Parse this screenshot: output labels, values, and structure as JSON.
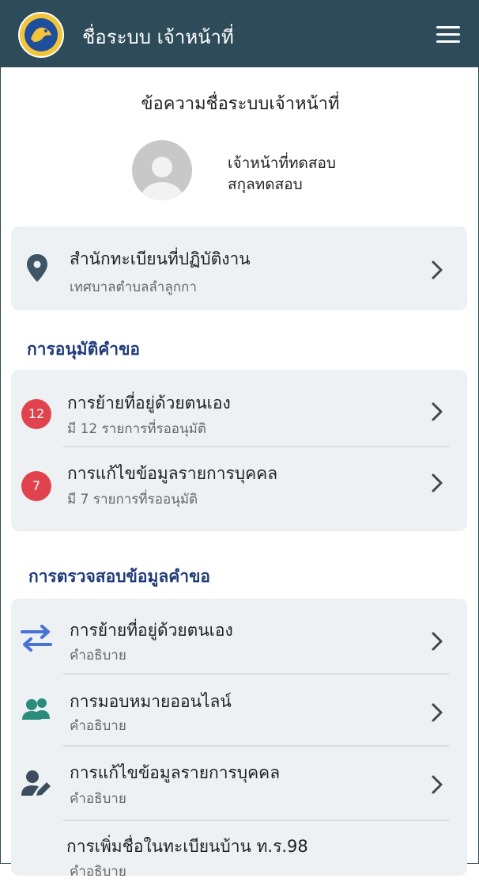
{
  "header": {
    "title": "ชื่อระบบ เจ้าหน้าที่",
    "logo_icon": "department-seal-logo",
    "menu_icon": "hamburger-menu-icon"
  },
  "greeting": "ข้อความชื่อระบบเจ้าหน้าที่",
  "user": {
    "name": "เจ้าหน้าที่ทดสอบ",
    "surname": "สกุลทดสอบ"
  },
  "office": {
    "title": "สำนักทะเบียนที่ปฏิบัติงาน",
    "value": "เทศบาลตำบลลำลูกกา"
  },
  "approval": {
    "section_title": "การอนุมัติคำขอ",
    "items": [
      {
        "badge": "12",
        "title": "การย้ายที่อยู่ด้วยตนเอง",
        "subtitle": "มี 12 รายการที่รออนุมัติ"
      },
      {
        "badge": "7",
        "title": "การแก้ไขข้อมูลรายการบุคคล",
        "subtitle": "มี 7 รายการที่รออนุมัติ"
      }
    ]
  },
  "verification": {
    "section_title": "การตรวจสอบข้อมูลคำขอ",
    "items": [
      {
        "icon": "swap-arrows-icon",
        "title": "การย้ายที่อยู่ด้วยตนเอง",
        "subtitle": "คำอธิบาย"
      },
      {
        "icon": "people-group-icon",
        "title": "การมอบหมายออนไลน์",
        "subtitle": "คำอธิบาย"
      },
      {
        "icon": "person-edit-icon",
        "title": "การแก้ไขข้อมูลรายการบุคคล",
        "subtitle": "คำอธิบาย"
      },
      {
        "icon": "",
        "title": "การเพิ่มชื่อในทะเบียนบ้าน ท.ร.98",
        "subtitle": "คำอธิบาย"
      }
    ]
  },
  "colors": {
    "header_bg": "#2e4b59",
    "card_bg": "#eef1f3",
    "section_title": "#1f3a7a",
    "badge": "#e0434d",
    "swap_icon": "#4a72d6",
    "people_icon": "#2a8c7a",
    "edit_icon": "#3b4d5e",
    "location_icon": "#3d5566"
  }
}
